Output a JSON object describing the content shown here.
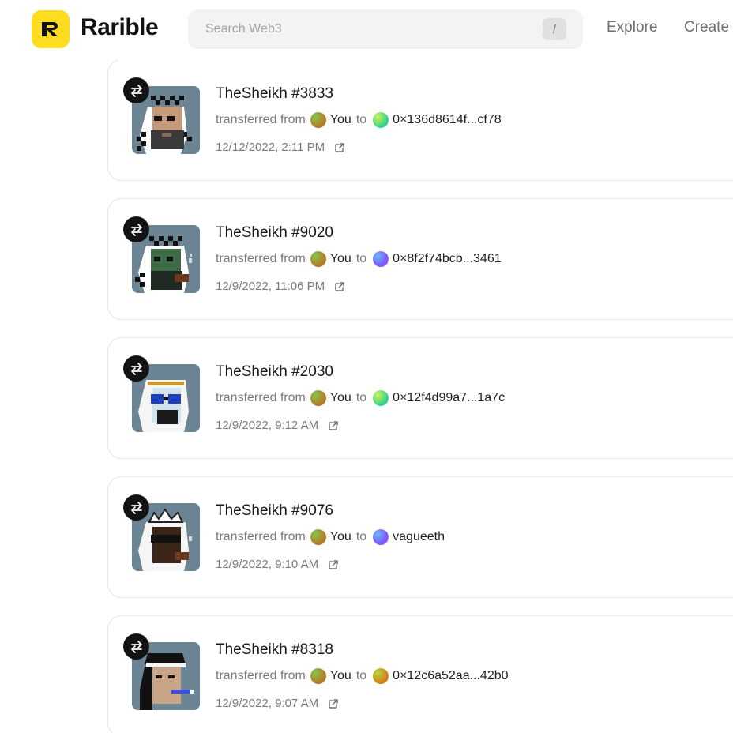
{
  "header": {
    "brand": "Rarible",
    "search_placeholder": "Search Web3",
    "search_shortcut": "/",
    "nav": [
      "Explore",
      "Create"
    ]
  },
  "colors": {
    "brand_yellow": "#fedc1f",
    "avatar_you": "#c45a12",
    "thumb_bg": "#6b8594"
  },
  "activity": [
    {
      "title": "TheSheikh #3833",
      "action_prefix": "transferred from",
      "from": "You",
      "connector": "to",
      "to": "0×136d8614f...cf78",
      "to_avatar": "green-gradient",
      "timestamp": "12/12/2022, 2:11 PM",
      "icon": "transfer-icon",
      "link_icon": "external-link-icon"
    },
    {
      "title": "TheSheikh #9020",
      "action_prefix": "transferred from",
      "from": "You",
      "connector": "to",
      "to": "0×8f2f74bcb...3461",
      "to_avatar": "blue-purple-gradient",
      "timestamp": "12/9/2022, 11:06 PM",
      "icon": "transfer-icon",
      "link_icon": "external-link-icon"
    },
    {
      "title": "TheSheikh #2030",
      "action_prefix": "transferred from",
      "from": "You",
      "connector": "to",
      "to": "0×12f4d99a7...1a7c",
      "to_avatar": "green-gradient",
      "timestamp": "12/9/2022, 9:12 AM",
      "icon": "transfer-icon",
      "link_icon": "external-link-icon"
    },
    {
      "title": "TheSheikh #9076",
      "action_prefix": "transferred from",
      "from": "You",
      "connector": "to",
      "to": "vagueeth",
      "to_avatar": "blue-purple-gradient",
      "timestamp": "12/9/2022, 9:10 AM",
      "icon": "transfer-icon",
      "link_icon": "external-link-icon"
    },
    {
      "title": "TheSheikh #8318",
      "action_prefix": "transferred from",
      "from": "You",
      "connector": "to",
      "to": "0×12c6a52aa...42b0",
      "to_avatar": "orange-green-gradient",
      "timestamp": "12/9/2022, 9:07 AM",
      "icon": "transfer-icon",
      "link_icon": "external-link-icon"
    }
  ]
}
